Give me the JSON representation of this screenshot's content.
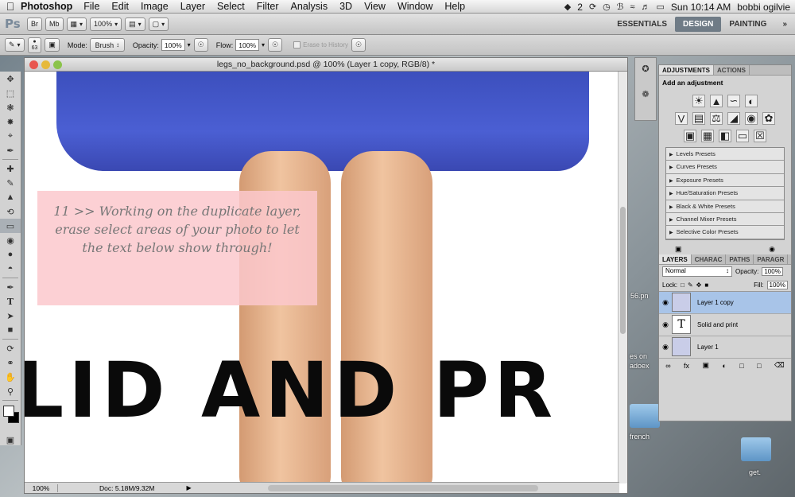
{
  "menubar": {
    "app": "Photoshop",
    "items": [
      "File",
      "Edit",
      "Image",
      "Layer",
      "Select",
      "Filter",
      "Analysis",
      "3D",
      "View",
      "Window",
      "Help"
    ],
    "badge": "2",
    "clock": "Sun 10:14 AM",
    "user": "bobbi ogilvie"
  },
  "appbar": {
    "logo": "Ps",
    "br": "Br",
    "mb": "Mb",
    "zoom": "100%",
    "workspaces": [
      "ESSENTIALS",
      "DESIGN",
      "PAINTING"
    ],
    "overflow": "»"
  },
  "options": {
    "brush_size": "63",
    "mode_label": "Mode:",
    "mode_value": "Brush",
    "opacity_label": "Opacity:",
    "opacity_value": "100%",
    "flow_label": "Flow:",
    "flow_value": "100%",
    "erase_history": "Erase to History"
  },
  "document": {
    "title": "legs_no_background.psd @ 100% (Layer 1 copy, RGB/8) *",
    "note": "11 >> Working on the duplicate layer, erase select areas of your photo to let the text below show through!",
    "big_text": "LID AND PR",
    "status_zoom": "100%",
    "status_doc": "Doc: 5.18M/9.32M"
  },
  "adjustments": {
    "tabs": [
      "ADJUSTMENTS",
      "ACTIONS"
    ],
    "title": "Add an adjustment",
    "presets": [
      "Levels Presets",
      "Curves Presets",
      "Exposure Presets",
      "Hue/Saturation Presets",
      "Black & White Presets",
      "Channel Mixer Presets",
      "Selective Color Presets"
    ]
  },
  "layers": {
    "tabs": [
      "LAYERS",
      "CHARAC",
      "PATHS",
      "PARAGR"
    ],
    "blend": "Normal",
    "opacity_label": "Opacity:",
    "opacity": "100%",
    "lock_label": "Lock:",
    "fill_label": "Fill:",
    "fill": "100%",
    "items": [
      {
        "name": "Layer 1 copy"
      },
      {
        "name": "Solid and print"
      },
      {
        "name": "Layer 1"
      }
    ]
  },
  "desktop": {
    "labels": [
      "56.pn",
      "es on",
      "adoex",
      "french",
      "get."
    ]
  }
}
